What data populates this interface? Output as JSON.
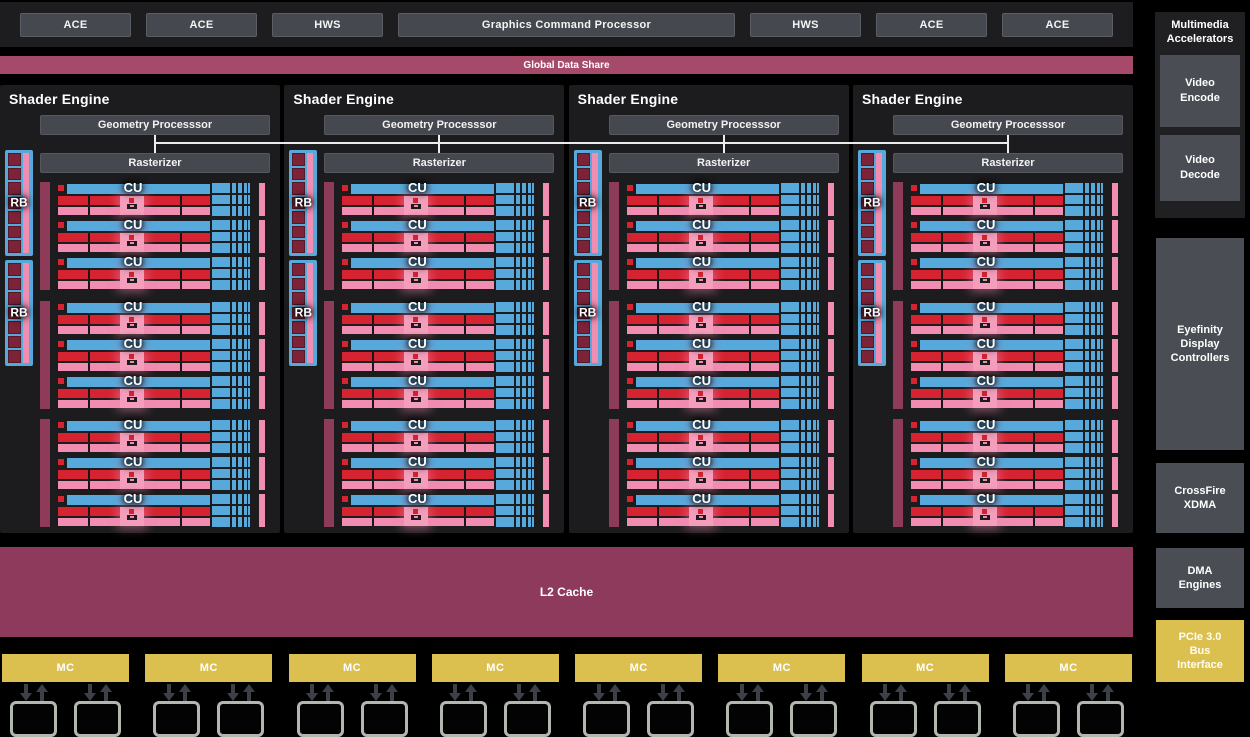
{
  "command_front_end": {
    "buttons": [
      "ACE",
      "ACE",
      "HWS",
      "Graphics Command Processor",
      "HWS",
      "ACE",
      "ACE"
    ]
  },
  "global_data_share": {
    "label": "Global Data Share"
  },
  "shader_engines": {
    "count": 4,
    "title": "Shader Engine",
    "geometry_processor_label": "Geometry Processsor",
    "rasterizer_label": "Rasterizer",
    "rb_label": "RB",
    "rb_blocks_per_engine": 2,
    "rb_squares_per_block": 7,
    "cu_label": "CU",
    "cu_groups_per_engine": 3,
    "cus_per_group": 3
  },
  "l2_cache": {
    "label": "L2 Cache"
  },
  "memory_controllers": {
    "label": "MC",
    "count": 8,
    "memory_chips_per_mc": 2
  },
  "sidebar": {
    "multimedia": {
      "title": "Multimedia\nAccelerators",
      "boxes": [
        "Video\nEncode",
        "Video\nDecode"
      ]
    },
    "boxes": [
      {
        "label": "Eyefinity\nDisplay\nControllers"
      },
      {
        "label": "CrossFire\nXDMA"
      },
      {
        "label": "DMA\nEngines"
      },
      {
        "label": "PCIe 3.0\nBus\nInterface"
      }
    ]
  },
  "colors": {
    "background": "#000000",
    "panel_dark": "#1c1c1e",
    "bar_gray": "#45484f",
    "global_data_share": "#a54a6a",
    "l2_cache": "#8e3a5d",
    "cu_blue": "#57a9dc",
    "cu_red": "#d52331",
    "cu_pink": "#f18db1",
    "group_bar_maroon": "#8d3b59",
    "rb_square_dark_red": "#7d2337",
    "mc_yellow": "#dcc04f",
    "sidebar_box_gray": "#4a4d54",
    "arrow_gray": "#3d4147",
    "memory_chip_border": "#b2b8b0",
    "connector_line": "#ececec"
  }
}
